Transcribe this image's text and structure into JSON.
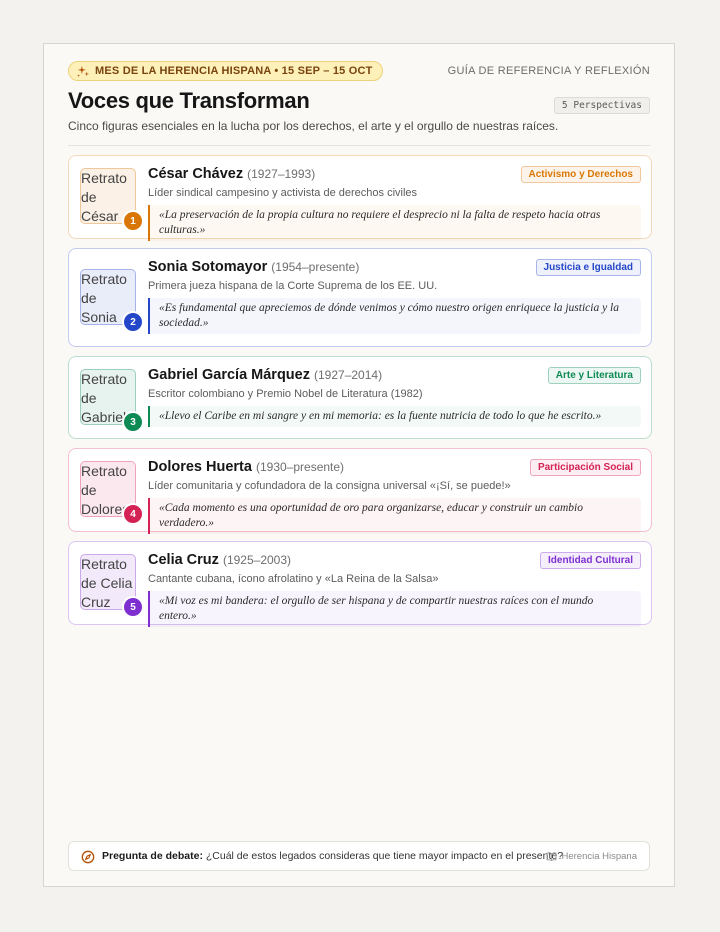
{
  "header": {
    "badge": "MES DE LA HERENCIA HISPANA • 15 SEP – 15 OCT",
    "guide_label": "GUÍA DE REFERENCIA Y REFLEXIÓN",
    "title": "Voces que Transforman",
    "count": "5 Perspectivas",
    "subtitle": "Cinco figuras esenciales en la lucha por los derechos, el arte y el orgullo de nuestras raíces."
  },
  "figures": [
    {
      "number": "1",
      "portrait_alt": "Retrato de César Chávez",
      "name": "César Chávez",
      "years": "(1927–1993)",
      "role": "Líder sindical campesino y activista de derechos civiles",
      "tag": "Activismo y Derechos",
      "quote": "«La preservación de la propia cultura no requiere el desprecio ni la falta de respeto hacia otras culturas.»",
      "color": "#d97706"
    },
    {
      "number": "2",
      "portrait_alt": "Retrato de Sonia Sotomayor",
      "name": "Sonia Sotomayor",
      "years": "(1954–presente)",
      "role": "Primera jueza hispana de la Corte Suprema de los EE. UU.",
      "tag": "Justicia e Igualdad",
      "quote": "«Es fundamental que apreciemos de dónde venimos y cómo nuestro origen enriquece la justicia y la sociedad.»",
      "color": "#2447c9"
    },
    {
      "number": "3",
      "portrait_alt": "Retrato de Gabriel García Márquez",
      "name": "Gabriel García Márquez",
      "years": "(1927–2014)",
      "role": "Escritor colombiano y Premio Nobel de Literatura (1982)",
      "tag": "Arte y Literatura",
      "quote": "«Llevo el Caribe en mi sangre y en mi memoria: es la fuente nutricia de todo lo que he escrito.»",
      "color": "#0e8a55"
    },
    {
      "number": "4",
      "portrait_alt": "Retrato de Dolores Huerta",
      "name": "Dolores Huerta",
      "years": "(1930–presente)",
      "role": "Líder comunitaria y cofundadora de la consigna universal «¡Sí, se puede!»",
      "tag": "Participación Social",
      "quote": "«Cada momento es una oportunidad de oro para organizarse, educar y construir un cambio verdadero.»",
      "color": "#d42254"
    },
    {
      "number": "5",
      "portrait_alt": "Retrato de Celia Cruz",
      "name": "Celia Cruz",
      "years": "(1925–2003)",
      "role": "Cantante cubana, ícono afrolatino y «La Reina de la Salsa»",
      "tag": "Identidad Cultural",
      "quote": "«Mi voz es mi bandera: el orgullo de ser hispana y de compartir nuestras raíces con el mundo entero.»",
      "color": "#7e2fd0"
    }
  ],
  "footer": {
    "question_label": "Pregunta de debate:",
    "question": "¿Cuál de estos legados consideras que tiene mayor impacto en el presente?",
    "brand": "Herencia Hispana"
  },
  "icons": {
    "badge": "sparkles-icon",
    "footer": "compass-icon",
    "brand": "book-icon"
  }
}
